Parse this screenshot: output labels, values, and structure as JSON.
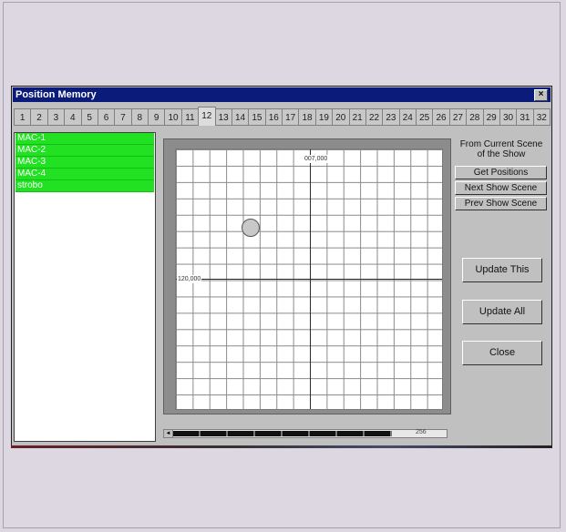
{
  "window": {
    "title": "Position Memory",
    "close_label": "×"
  },
  "tabs": [
    "1",
    "2",
    "3",
    "4",
    "5",
    "6",
    "7",
    "8",
    "9",
    "10",
    "11",
    "12",
    "13",
    "14",
    "15",
    "16",
    "17",
    "18",
    "19",
    "20",
    "21",
    "22",
    "23",
    "24",
    "25",
    "26",
    "27",
    "28",
    "29",
    "30",
    "31",
    "32"
  ],
  "active_tab": "12",
  "fixtures": [
    "MAC-1",
    "MAC-2",
    "MAC-3",
    "MAC-4",
    "strobo"
  ],
  "plot": {
    "x_axis_label": "120,000",
    "y_axis_label": "007,000",
    "marker": {
      "x_fraction": 0.28,
      "y_fraction": 0.3
    }
  },
  "scroll": {
    "value_label": "256",
    "fill_fraction": 0.8
  },
  "side_panel": {
    "caption_line1": "From Current Scene",
    "caption_line2": "of the Show",
    "get_positions_label": "Get Positions",
    "next_scene_label": "Next Show Scene",
    "prev_scene_label": "Prev Show Scene",
    "update_this_label": "Update This",
    "update_all_label": "Update All",
    "close_label": "Close"
  }
}
